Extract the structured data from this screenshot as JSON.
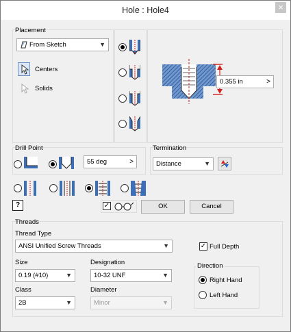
{
  "window": {
    "title": "Hole : Hole4",
    "close_glyph": "×"
  },
  "placement": {
    "label": "Placement",
    "source_value": "From Sketch",
    "centers_label": "Centers",
    "solids_label": "Solids"
  },
  "dimension": {
    "value": "0.355 in",
    "arrow": ">"
  },
  "drill_point": {
    "label": "Drill Point",
    "angle_value": "55 deg",
    "arrow": ">"
  },
  "termination": {
    "label": "Termination",
    "value": "Distance"
  },
  "buttons": {
    "help": "?",
    "ok": "OK",
    "cancel": "Cancel"
  },
  "threads": {
    "label": "Threads",
    "thread_type_label": "Thread Type",
    "thread_type_value": "ANSI Unified Screw Threads",
    "full_depth_label": "Full Depth",
    "size_label": "Size",
    "size_value": "0.19 (#10)",
    "designation_label": "Designation",
    "designation_value": "10-32 UNF",
    "class_label": "Class",
    "class_value": "2B",
    "diameter_label": "Diameter",
    "diameter_value": "Minor",
    "direction_label": "Direction",
    "right_hand_label": "Right Hand",
    "left_hand_label": "Left Hand"
  },
  "colors": {
    "hatch": "#3c6fb8",
    "accent_red": "#d21f1f"
  }
}
